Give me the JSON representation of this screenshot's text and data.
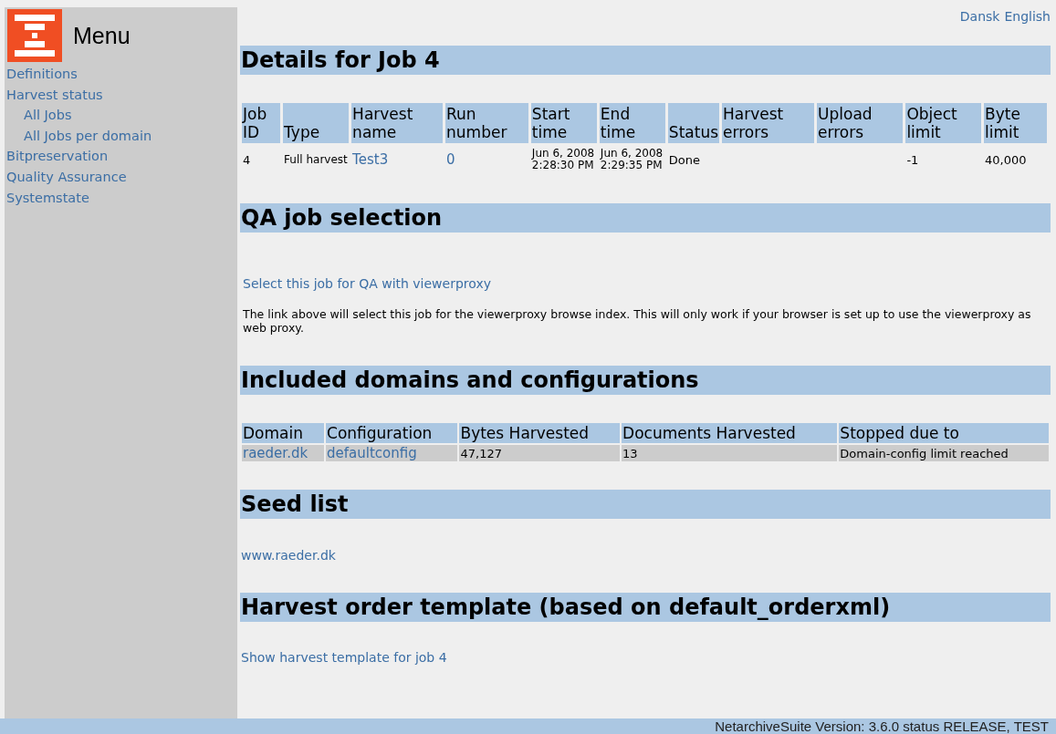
{
  "menu": {
    "title": "Menu",
    "items": [
      {
        "label": "Definitions"
      },
      {
        "label": "Harvest status",
        "children": [
          {
            "label": "All Jobs"
          },
          {
            "label": "All Jobs per domain"
          }
        ]
      },
      {
        "label": "Bitpreservation"
      },
      {
        "label": "Quality Assurance"
      },
      {
        "label": "Systemstate"
      }
    ]
  },
  "languages": [
    "Dansk",
    "English"
  ],
  "details": {
    "heading": "Details for Job 4",
    "columns": [
      "Job ID",
      "Type",
      "Harvest name",
      "Run number",
      "Start time",
      "End time",
      "Status",
      "Harvest errors",
      "Upload errors",
      "Object limit",
      "Byte limit"
    ],
    "row": [
      {
        "text": "4",
        "kind": "text"
      },
      {
        "text": "Full harvest",
        "kind": "small"
      },
      {
        "text": "Test3",
        "kind": "link"
      },
      {
        "text": "0",
        "kind": "link"
      },
      {
        "text": "Jun 6, 2008 2:28:30 PM",
        "kind": "small"
      },
      {
        "text": "Jun 6, 2008 2:29:35 PM",
        "kind": "small"
      },
      {
        "text": "Done",
        "kind": "text"
      },
      {
        "kind": "empty"
      },
      {
        "kind": "empty"
      },
      {
        "text": "-1",
        "kind": "text"
      },
      {
        "text": "40,000",
        "kind": "text"
      }
    ]
  },
  "qa": {
    "heading": "QA job selection",
    "link": "Select this job for QA with viewerproxy",
    "note": "The link above will select this job for the viewerproxy browse index. This will only work if your browser is set up to use the viewerproxy as web proxy."
  },
  "domains": {
    "heading": "Included domains and configurations",
    "columns": [
      "Domain",
      "Configuration",
      "Bytes Harvested",
      "Documents Harvested",
      "Stopped due to"
    ],
    "rows": [
      [
        {
          "text": "raeder.dk",
          "kind": "link"
        },
        {
          "text": "defaultconfig",
          "kind": "link"
        },
        {
          "text": "47,127",
          "kind": "text"
        },
        {
          "text": "13",
          "kind": "text"
        },
        {
          "text": "Domain-config limit reached",
          "kind": "text"
        }
      ]
    ]
  },
  "seeds": {
    "heading": "Seed list",
    "items": [
      "www.raeder.dk"
    ]
  },
  "template": {
    "heading": "Harvest order template (based on default_orderxml)",
    "link": "Show harvest template for job 4"
  },
  "footer": "NetarchiveSuite Version: 3.6.0 status RELEASE, TEST"
}
